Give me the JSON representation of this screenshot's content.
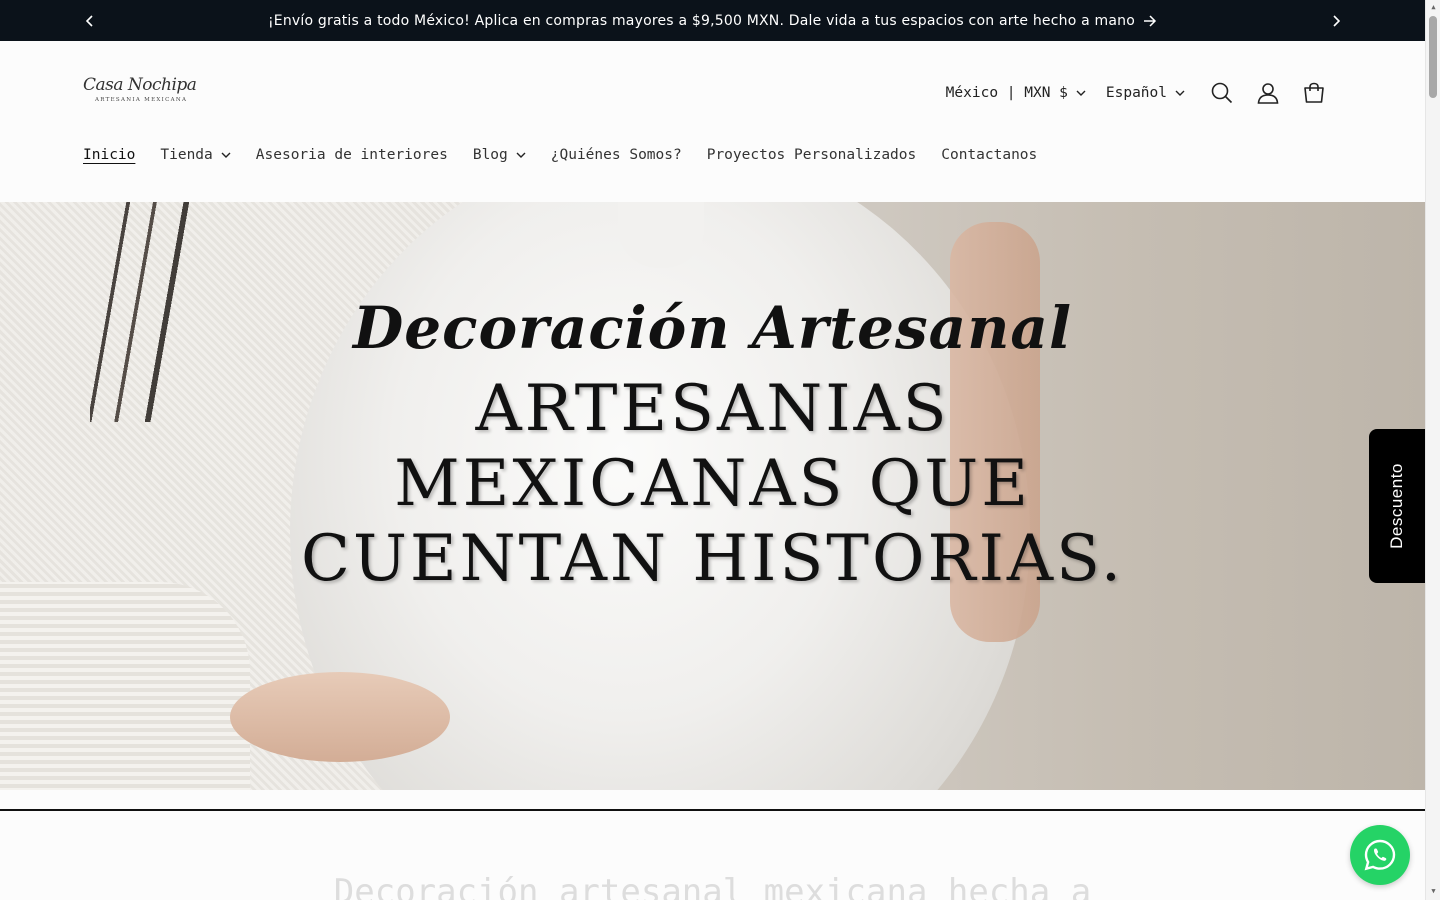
{
  "announcement": {
    "text": "¡Envío gratis a todo México! Aplica en compras mayores a $9,500 MXN. Dale vida a tus espacios con arte hecho a mano",
    "prev_icon": "chevron-left-icon",
    "next_icon": "chevron-right-icon",
    "link_icon": "arrow-right-icon"
  },
  "logo": {
    "script": "Casa Nochipa",
    "sub": "ARTESANIA MEXICANA"
  },
  "header": {
    "country_currency": "México | MXN $",
    "language": "Español",
    "icons": [
      "search-icon",
      "account-icon",
      "cart-icon"
    ]
  },
  "nav": {
    "items": [
      {
        "label": "Inicio",
        "active": true,
        "dropdown": false
      },
      {
        "label": "Tienda",
        "active": false,
        "dropdown": true
      },
      {
        "label": "Asesoria de interiores",
        "active": false,
        "dropdown": false
      },
      {
        "label": "Blog",
        "active": false,
        "dropdown": true
      },
      {
        "label": "¿Quiénes Somos?",
        "active": false,
        "dropdown": false
      },
      {
        "label": "Proyectos Personalizados",
        "active": false,
        "dropdown": false
      },
      {
        "label": "Contactanos",
        "active": false,
        "dropdown": false
      }
    ]
  },
  "hero": {
    "script": "Decoración Artesanal",
    "line1": "ARTESANIAS",
    "line2": "MEXICANAS QUE",
    "line3": "CUENTAN HISTORIAS."
  },
  "discount_tab": {
    "label": "Descuento"
  },
  "section": {
    "title": "Decoración artesanal mexicana hecha a"
  },
  "colors": {
    "announcement_bg": "#0b121a",
    "whatsapp": "#25d366",
    "discount_bg": "#000000"
  }
}
